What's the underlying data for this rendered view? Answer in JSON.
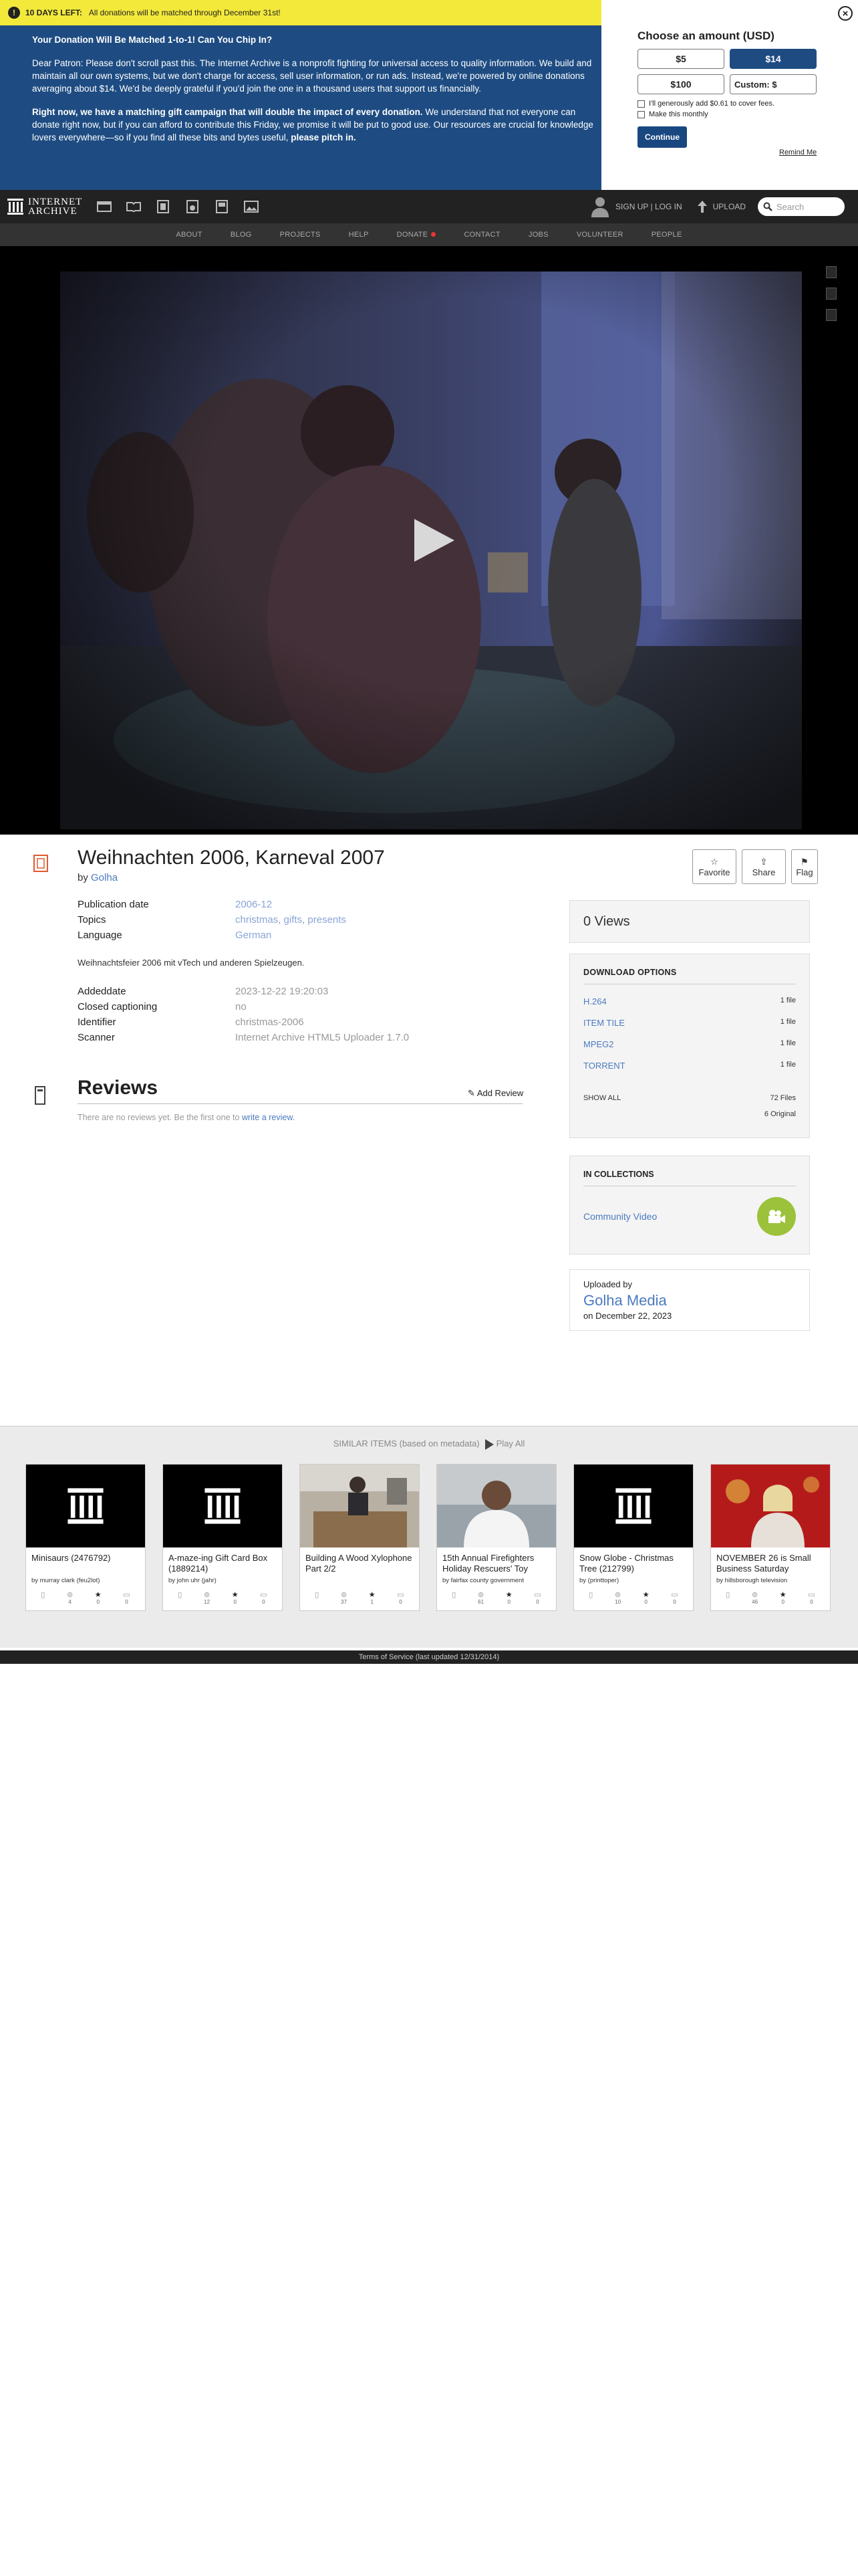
{
  "banner": {
    "urgent_label": "10 DAYS LEFT:",
    "urgent_text": "All donations will be matched through December 31st!",
    "heading": "Your Donation Will Be Matched 1-to-1! Can You Chip In?",
    "para1": "Dear Patron: Please don't scroll past this. The Internet Archive is a nonprofit fighting for universal access to quality information. We build and maintain all our own systems, but we don't charge for access, sell user information, or run ads. Instead, we're powered by online donations averaging about $14. We'd be deeply grateful if you'd join the one in a thousand users that support us financially.",
    "para2_bold": "Right now, we have a matching gift campaign that will double the impact of every donation.",
    "para2_text": " We understand that not everyone can donate right now, but if you can afford to contribute this Friday, we promise it will be put to good use. Our resources are crucial for knowledge lovers everywhere—so if you find all these bits and bytes useful, ",
    "para2_end": "please pitch in.",
    "close": "×",
    "choose": "Choose an amount (USD)",
    "amounts": [
      "$5",
      "$14",
      "$100",
      "Custom: $"
    ],
    "cover_fees": "I'll generously add $0.61 to cover fees.",
    "monthly": "Make this monthly",
    "continue": "Continue",
    "remind": "Remind Me"
  },
  "nav": {
    "logo_line1": "INTERNET",
    "logo_line2": "ARCHIVE",
    "signup": "SIGN UP | LOG IN",
    "upload": "UPLOAD",
    "search_placeholder": "Search",
    "sub": [
      "ABOUT",
      "BLOG",
      "PROJECTS",
      "HELP",
      "DONATE",
      "CONTACT",
      "JOBS",
      "VOLUNTEER",
      "PEOPLE"
    ]
  },
  "item": {
    "title": "Weihnachten 2006, Karneval 2007",
    "by": "by",
    "author": "Golha",
    "actions": [
      "Favorite",
      "Share",
      "Flag"
    ],
    "meta": {
      "pub_label": "Publication date",
      "pub_value": "2006-12",
      "topics_label": "Topics",
      "topics": [
        "christmas",
        "gifts",
        "presents"
      ],
      "lang_label": "Language",
      "lang_value": "German"
    },
    "description": "Weihnachtsfeier 2006 mit vTech und anderen Spielzeugen.",
    "meta2": [
      {
        "k": "Addeddate",
        "v": "2023-12-22 19:20:03"
      },
      {
        "k": "Closed captioning",
        "v": "no"
      },
      {
        "k": "Identifier",
        "v": "christmas-2006"
      },
      {
        "k": "Scanner",
        "v": "Internet Archive HTML5 Uploader 1.7.0"
      }
    ]
  },
  "reviews": {
    "title": "Reviews",
    "add": "Add Review",
    "none_text": "There are no reviews yet. Be the first one to ",
    "write": "write a review."
  },
  "sidebar": {
    "views": "0 Views",
    "dl_title": "DOWNLOAD OPTIONS",
    "files": [
      {
        "name": "H.264",
        "count": "1 file"
      },
      {
        "name": "ITEM TILE",
        "count": "1 file"
      },
      {
        "name": "MPEG2",
        "count": "1 file"
      },
      {
        "name": "TORRENT",
        "count": "1 file"
      }
    ],
    "show_all": "SHOW ALL",
    "total_files": "72 Files",
    "original": "6 Original",
    "coll_title": "IN COLLECTIONS",
    "collection": "Community Video",
    "uploaded_by": "Uploaded by",
    "uploader": "Golha Media",
    "uploaded_on": "on December 22, 2023"
  },
  "similar": {
    "heading": "SIMILAR ITEMS (based on metadata)",
    "play_all": "Play All",
    "tiles": [
      {
        "title": "Minisaurs (2476792)",
        "by": "by murray clark (feu2lot)",
        "s1": "",
        "s2": "4",
        "s3": "0",
        "s4": "0",
        "thumb": "temple"
      },
      {
        "title": "A-maze-ing Gift Card Box (1889214)",
        "by": "by john uhr (jahr)",
        "s1": "",
        "s2": "12",
        "s3": "0",
        "s4": "0",
        "thumb": "temple"
      },
      {
        "title": "Building A Wood Xylophone Part 2/2",
        "by": "",
        "s1": "",
        "s2": "37",
        "s3": "1",
        "s4": "0",
        "thumb": "workshop"
      },
      {
        "title": "15th Annual Firefighters Holiday Rescuers' Toy",
        "by": "by fairfax county government",
        "s1": "",
        "s2": "61",
        "s3": "0",
        "s4": "0",
        "thumb": "person"
      },
      {
        "title": "Snow Globe - Christmas Tree (212799)",
        "by": "by (printtoper)",
        "s1": "",
        "s2": "10",
        "s3": "0",
        "s4": "0",
        "thumb": "temple"
      },
      {
        "title": "NOVEMBER 26 is Small Business Saturday",
        "by": "by hillsborough television",
        "s1": "",
        "s2": "46",
        "s3": "0",
        "s4": "0",
        "thumb": "anchor"
      }
    ]
  },
  "footer": "Terms of Service (last updated 12/31/2014)",
  "colors": {
    "banner": "#1e4c82",
    "urgent": "#f3e93b",
    "link": "#4a7ac0",
    "collection": "#9bc23a"
  }
}
